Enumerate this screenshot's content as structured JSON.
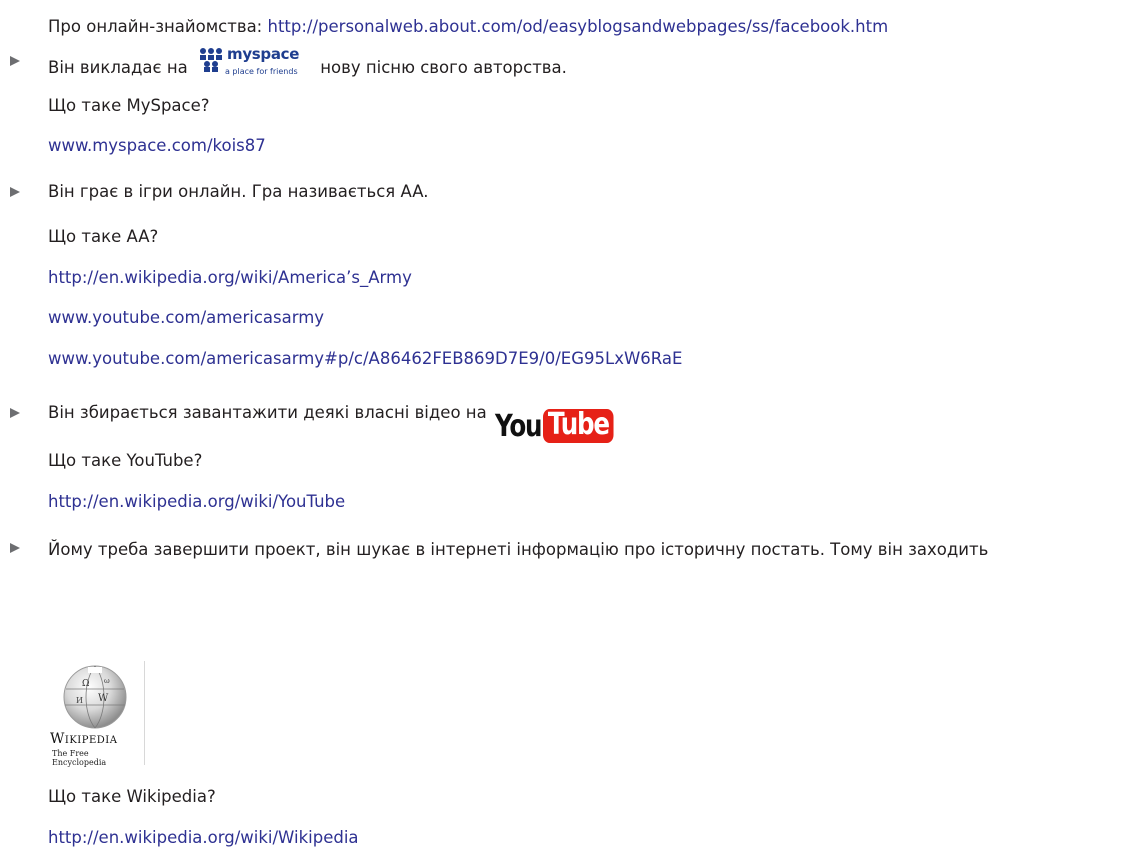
{
  "lines": {
    "dating_label": "Про онлайн-знайомства: ",
    "dating_link": "http://personalweb.about.com/od/easyblogsandwebpages/ss/facebook.htm",
    "myspace_before": "Він викладає на ",
    "myspace_after": " нову пісню свого авторства.",
    "myspace_question": "Що таке MySpace?",
    "myspace_link": "www.myspace.com/kois87",
    "games_text": "Він грає в ігри онлайн. Гра називається AA.",
    "games_question": "Що таке AA?",
    "aa_link_1": "http://en.wikipedia.org/wiki/America’s_Army",
    "aa_link_2": "www.youtube.com/americasarmy",
    "aa_link_3": "www.youtube.com/americasarmy#p/c/A86462FEB869D7E9/0/EG95LxW6RaE",
    "youtube_text": "Він збирається завантажити деякі власні відео на",
    "youtube_question": "Що таке YouTube?",
    "youtube_link": "http://en.wikipedia.org/wiki/YouTube",
    "wiki_text": "Йому треба завершити проект, він шукає в інтернеті інформацію про історичну постать. Тому він заходить",
    "wiki_question": "Що таке Wikipedia?",
    "wiki_link": "http://en.wikipedia.org/wiki/Wikipedia"
  },
  "logos": {
    "myspace_word": "myspace",
    "myspace_tagline": "a place for friends",
    "youtube_you": "You",
    "youtube_tube": "Tube",
    "wikipedia_word": "Wikipedia",
    "wikipedia_tagline": "The Free Encyclopedia"
  },
  "colors": {
    "text": "#231f20",
    "link": "#2e3192",
    "bullet": "#6d6e71",
    "youtube_red": "#e62117",
    "myspace_blue": "#1f3e8f"
  }
}
